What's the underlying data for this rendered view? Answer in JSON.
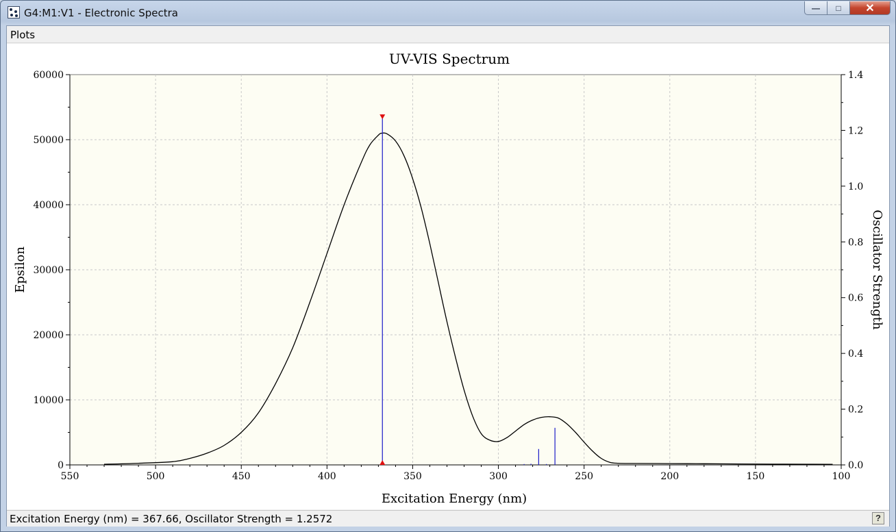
{
  "window": {
    "title": "G4:M1:V1 - Electronic Spectra"
  },
  "menu": {
    "plots": "Plots"
  },
  "status": {
    "text": "Excitation Energy (nm) = 367.66, Oscillator Strength = 1.2572"
  },
  "colors": {
    "plot_background": "#fdfdf3",
    "curve": "#000000",
    "sticks": "#1a1ac8",
    "marker": "#e01010",
    "grid": "#c8c8c8"
  },
  "chart_data": {
    "type": "line",
    "title": "UV-VIS Spectrum",
    "xlabel": "Excitation Energy (nm)",
    "ylabel": "Epsilon",
    "y2label": "Oscillator Strength",
    "xlim": [
      550,
      100
    ],
    "ylim": [
      0,
      60000
    ],
    "y2lim": [
      0,
      1.4
    ],
    "xticks": [
      "550",
      "500",
      "450",
      "400",
      "350",
      "300",
      "250",
      "200",
      "150",
      "100"
    ],
    "yticks": [
      "0",
      "10000",
      "20000",
      "30000",
      "40000",
      "50000",
      "60000"
    ],
    "y2ticks": [
      "0.0",
      "0.2",
      "0.4",
      "0.6",
      "0.8",
      "1.0",
      "1.2",
      "1.4"
    ],
    "grid": true,
    "series": [
      {
        "name": "",
        "x": [
          530,
          510,
          490,
          480,
          470,
          460,
          450,
          440,
          430,
          420,
          410,
          400,
          390,
          380,
          375,
          370,
          368,
          365,
          360,
          355,
          350,
          345,
          340,
          335,
          330,
          325,
          320,
          315,
          310,
          305,
          300,
          295,
          290,
          285,
          280,
          275,
          270,
          265,
          260,
          255,
          250,
          245,
          240,
          235,
          230,
          220,
          200,
          180,
          160,
          140,
          120,
          105
        ],
        "y": [
          100,
          250,
          500,
          1000,
          1800,
          3000,
          5000,
          8000,
          12500,
          18000,
          25000,
          32500,
          40000,
          46500,
          49200,
          50700,
          51000,
          50900,
          49800,
          47500,
          44000,
          39500,
          34000,
          28000,
          22000,
          16500,
          11500,
          7500,
          4800,
          3800,
          3600,
          4200,
          5200,
          6200,
          6900,
          7300,
          7400,
          7200,
          6300,
          5000,
          3500,
          2100,
          1000,
          400,
          250,
          220,
          200,
          180,
          150,
          120,
          100,
          80
        ]
      }
    ],
    "sticks": [
      {
        "x": 367.66,
        "strength": 1.2572
      },
      {
        "x": 276.5,
        "strength": 0.057
      },
      {
        "x": 267.0,
        "strength": 0.133
      },
      {
        "x": 285.0,
        "strength": 0.003
      },
      {
        "x": 281.0,
        "strength": 0.004
      },
      {
        "x": 272.0,
        "strength": 0.003
      }
    ],
    "selected_stick": 0
  }
}
